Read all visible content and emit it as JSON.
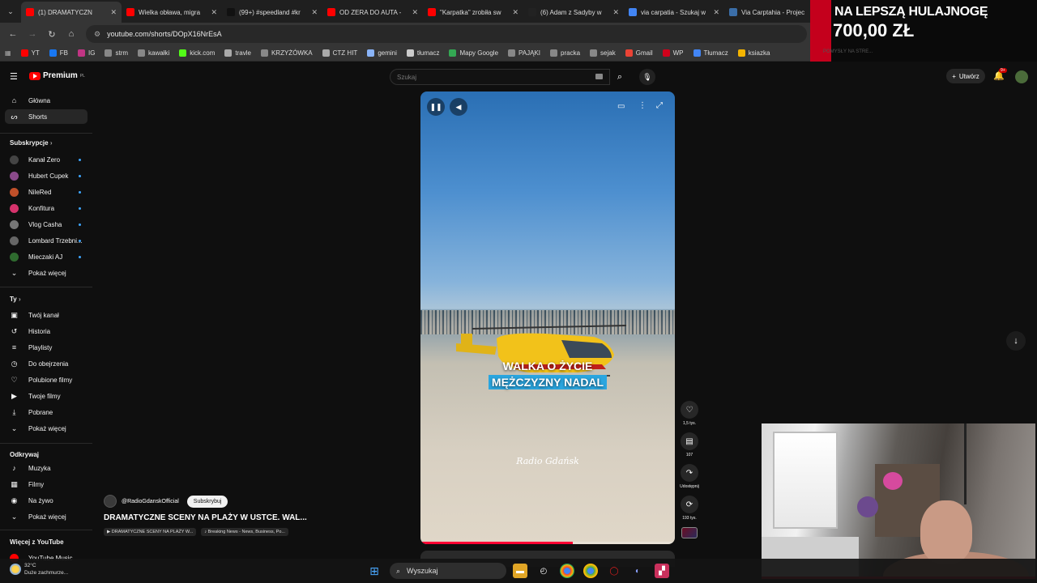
{
  "browser": {
    "tabs": [
      {
        "title": "(1) DRAMATYCZN",
        "color": "#ff0000",
        "active": true
      },
      {
        "title": "Wielka obława, migra",
        "color": "#ff0000",
        "active": false
      },
      {
        "title": "(99+) #speedland #kr",
        "color": "#111111",
        "active": false
      },
      {
        "title": "OD ZERA DO AUTA - ",
        "color": "#ff0000",
        "active": false
      },
      {
        "title": "\"Karpatka\" zrobiła sw",
        "color": "#ff0000",
        "active": false
      },
      {
        "title": "(6) Adam z Sadyby w",
        "color": "#222222",
        "active": false
      },
      {
        "title": "via carpatia - Szukaj w",
        "color": "#4285f4",
        "active": false
      },
      {
        "title": "Via Carptahia - Projec",
        "color": "#3b6ea8",
        "active": false
      }
    ],
    "url": "youtube.com/shorts/DOpX16NrEsA",
    "bookmarks": [
      {
        "label": "YT",
        "color": "#ff0000"
      },
      {
        "label": "FB",
        "color": "#1877f2"
      },
      {
        "label": "IG",
        "color": "#c13584"
      },
      {
        "label": "strm",
        "color": "#888888"
      },
      {
        "label": "kawałki",
        "color": "#888888"
      },
      {
        "label": "kick.com",
        "color": "#53fc18"
      },
      {
        "label": "travle",
        "color": "#aaaaaa"
      },
      {
        "label": "KRZYŻÓWKA",
        "color": "#888888"
      },
      {
        "label": "CTZ HIT",
        "color": "#aaaaaa"
      },
      {
        "label": "gemini",
        "color": "#8ab4f8"
      },
      {
        "label": "tłumacz",
        "color": "#cccccc"
      },
      {
        "label": "Mapy Google",
        "color": "#34a853"
      },
      {
        "label": "PAJĄKI",
        "color": "#888888"
      },
      {
        "label": "pracka",
        "color": "#888888"
      },
      {
        "label": "sejak",
        "color": "#888888"
      },
      {
        "label": "Gmail",
        "color": "#ea4335"
      },
      {
        "label": "WP",
        "color": "#d0021b"
      },
      {
        "label": "Tłumacz",
        "color": "#4285f4"
      },
      {
        "label": "ksiazka",
        "color": "#f4b400"
      }
    ]
  },
  "youtube": {
    "logo": "Premium",
    "logo_sup": "PL",
    "search_placeholder": "Szukaj",
    "create_label": "Utwórz",
    "notif_count": "9+",
    "nav": [
      {
        "label": "Główna",
        "icon": "⌂"
      },
      {
        "label": "Shorts",
        "icon": "ᔕ"
      }
    ],
    "subs_header": "Subskrypcje",
    "subs": [
      {
        "label": "Kanał Zero",
        "color": "#444444"
      },
      {
        "label": "Hubert Cupek",
        "color": "#8a4a8a"
      },
      {
        "label": "NileRed",
        "color": "#c0502a"
      },
      {
        "label": "Konfitura",
        "color": "#d6336c"
      },
      {
        "label": "Vlog Casha",
        "color": "#777777"
      },
      {
        "label": "Lombard Trzebni...",
        "color": "#666666"
      },
      {
        "label": "Mieczaki AJ",
        "color": "#2f6b2f"
      }
    ],
    "show_more": "Pokaż więcej",
    "you_header": "Ty",
    "you_items": [
      {
        "label": "Twój kanał",
        "icon": "▣"
      },
      {
        "label": "Historia",
        "icon": "↺"
      },
      {
        "label": "Playlisty",
        "icon": "≡"
      },
      {
        "label": "Do obejrzenia",
        "icon": "◷"
      },
      {
        "label": "Polubione filmy",
        "icon": "♡"
      },
      {
        "label": "Twoje filmy",
        "icon": "▶"
      },
      {
        "label": "Pobrane",
        "icon": "⤓"
      },
      {
        "label": "Pokaż więcej",
        "icon": "⌄"
      }
    ],
    "explore_header": "Odkrywaj",
    "explore_items": [
      {
        "label": "Muzyka",
        "icon": "♪"
      },
      {
        "label": "Filmy",
        "icon": "▦"
      },
      {
        "label": "Na żywo",
        "icon": "◉"
      },
      {
        "label": "Pokaż więcej",
        "icon": "⌄"
      }
    ],
    "more_header": "Więcej z YouTube",
    "more_item": "YouTube Music"
  },
  "short": {
    "caption_line1": "WALKA O ŻYCIE",
    "caption_line2": "MĘŻCZYZNY NADAL",
    "watermark": "Radio Gdańsk",
    "progress": 0.6,
    "likes": "1,5 tys.",
    "comments": "107",
    "share": "Udostępnij",
    "remix": "193 tys.",
    "channel": "@RadioGdanskOfficial",
    "subscribe": "Subskrybuj",
    "title": "DRAMATYCZNE SCENY NA PLAŻY W USTCE. WAL...",
    "chip1": "▶ DRAMATYCZNE SCENY NA PLAŻY W...",
    "chip2": "♪ Breaking News - News, Business, Po..."
  },
  "overlay": {
    "line1": "NA LEPSZĄ HULAJNOGĘ",
    "line2": "700,00 ZŁ",
    "line3": "POMYSŁY NA STRE..."
  },
  "taskbar": {
    "temp": "32°C",
    "weather": "Duże zachmurze...",
    "search": "Wyszukaj"
  }
}
